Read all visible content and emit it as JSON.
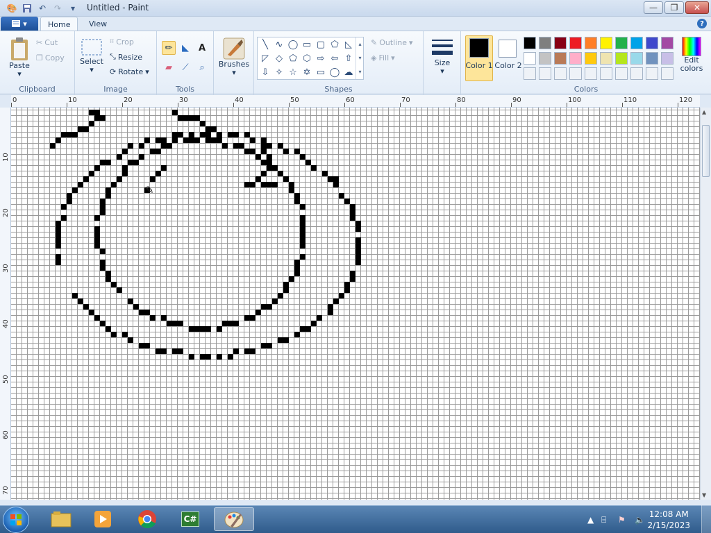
{
  "window": {
    "title": "Untitled - Paint",
    "minimize": "—",
    "maximize": "❐",
    "close": "✕"
  },
  "qat": {
    "icons": [
      "paint-app-icon",
      "save-icon",
      "undo-icon",
      "redo-icon",
      "customize-icon"
    ]
  },
  "tabs": {
    "file": "▾",
    "home": "Home",
    "view": "View"
  },
  "clipboard": {
    "paste": "Paste",
    "cut": "Cut",
    "copy": "Copy",
    "label": "Clipboard"
  },
  "image": {
    "select": "Select",
    "crop": "Crop",
    "resize": "Resize",
    "rotate": "Rotate",
    "label": "Image"
  },
  "tools": {
    "label": "Tools",
    "selected": "pencil"
  },
  "brushes": {
    "label": "Brushes"
  },
  "shapes": {
    "label": "Shapes",
    "outline": "Outline",
    "fill": "Fill"
  },
  "size": {
    "label": "Size"
  },
  "colors": {
    "color1_label": "Color 1",
    "color2_label": "Color 2",
    "label": "Colors",
    "edit_label": "Edit colors",
    "color1": "#000000",
    "color2": "#ffffff",
    "palette_row1": [
      "#000000",
      "#7f7f7f",
      "#880015",
      "#ed1c24",
      "#ff7f27",
      "#fff200",
      "#22b14c",
      "#00a2e8",
      "#3f48cc",
      "#a349a4"
    ],
    "palette_row2": [
      "#ffffff",
      "#c3c3c3",
      "#b97a57",
      "#ffaec9",
      "#ffc90e",
      "#efe4b0",
      "#b5e61d",
      "#99d9ea",
      "#7092be",
      "#c8bfe7"
    ]
  },
  "ruler": {
    "h_ticks": [
      "0",
      "10",
      "20",
      "30",
      "40",
      "50",
      "60",
      "70",
      "80",
      "90",
      "100",
      "110",
      "120"
    ],
    "v_ticks": [
      "10",
      "20",
      "30",
      "40",
      "50",
      "60",
      "70"
    ]
  },
  "taskbar": {
    "apps": [
      "explorer-icon",
      "media-player-icon",
      "chrome-icon",
      "csharp-icon",
      "paint-icon"
    ],
    "time": "12:08 AM",
    "date": "2/15/2023"
  }
}
